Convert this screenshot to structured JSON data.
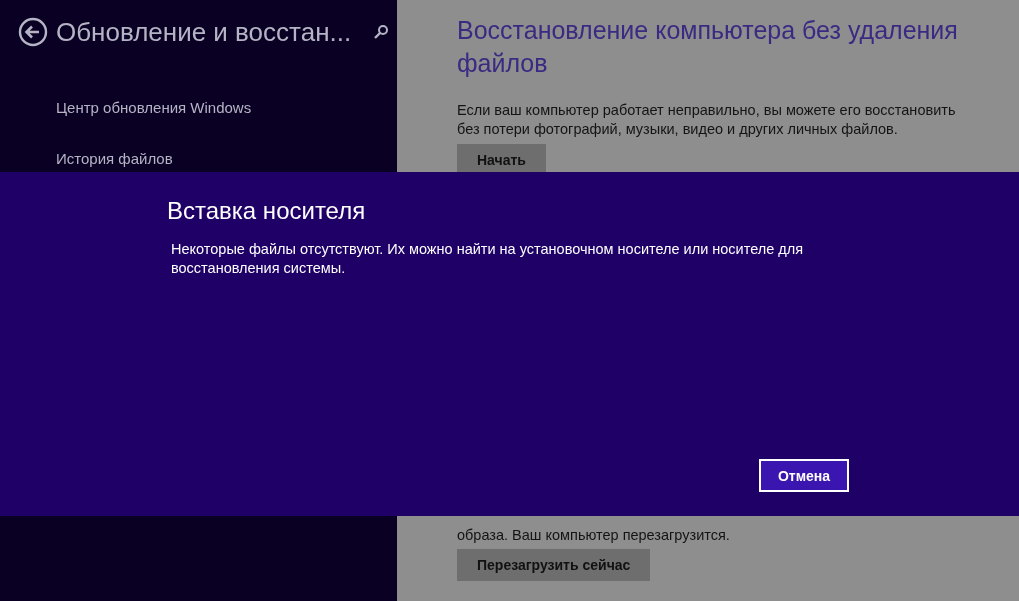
{
  "sidebar": {
    "title": "Обновление и восстан...",
    "items": [
      "Центр обновления Windows",
      "История файлов"
    ]
  },
  "content": {
    "heading": "Восстановление компьютера без удаления файлов",
    "description": "Если ваш компьютер работает неправильно, вы можете его восстановить без потери фотографий, музыки, видео и других личных файлов.",
    "start_button": "Начать",
    "restart_text": "образа. Ваш компьютер перезагрузится.",
    "restart_button": "Перезагрузить сейчас"
  },
  "dialog": {
    "title": "Вставка носителя",
    "message": "Некоторые файлы отсутствуют. Их можно найти на установочном носителе или носителе для восстановления системы.",
    "cancel_button": "Отмена"
  }
}
